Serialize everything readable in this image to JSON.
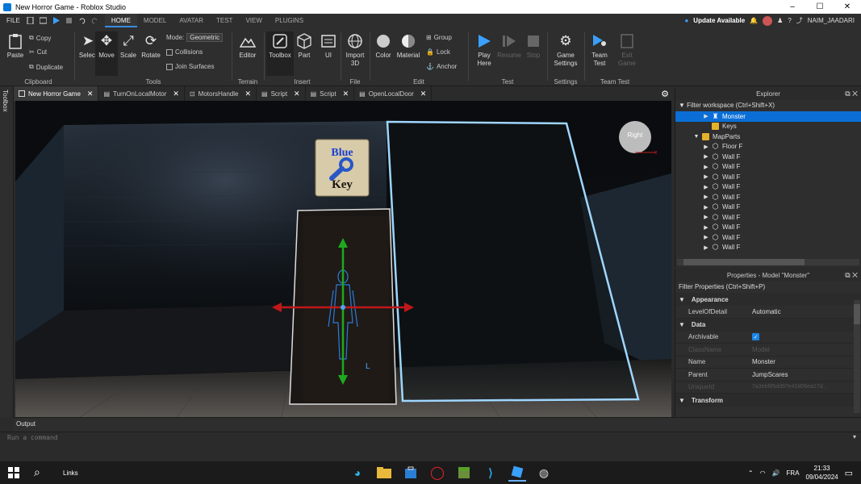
{
  "window": {
    "title": "New Horror Game - Roblox Studio",
    "controls": [
      "–",
      "☐",
      "✕"
    ]
  },
  "menubar": {
    "file": "FILE",
    "tabs": [
      "HOME",
      "MODEL",
      "AVATAR",
      "TEST",
      "VIEW",
      "PLUGINS"
    ],
    "active_tab": "HOME",
    "update": "Update Available",
    "username": "NAIM_JAADARI"
  },
  "ribbon": {
    "clipboard": {
      "label": "Clipboard",
      "paste": "Paste",
      "copy": "Copy",
      "cut": "Cut",
      "duplicate": "Duplicate"
    },
    "tools": {
      "label": "Tools",
      "select": "Select",
      "move": "Move",
      "scale": "Scale",
      "rotate": "Rotate",
      "mode_label": "Mode:",
      "mode_value": "Geometric",
      "collisions": "Collisions",
      "join_surfaces": "Join Surfaces"
    },
    "terrain": {
      "label": "Terrain",
      "editor": "Editor"
    },
    "insert": {
      "label": "Insert",
      "toolbox": "Toolbox",
      "part": "Part",
      "ui": "UI"
    },
    "file": {
      "label": "File",
      "import3d": "Import 3D"
    },
    "edit": {
      "label": "Edit",
      "color": "Color",
      "material": "Material",
      "group": "Group",
      "lock": "Lock",
      "anchor": "Anchor"
    },
    "test": {
      "label": "Test",
      "play_here": "Play Here",
      "resume": "Resume",
      "stop": "Stop"
    },
    "settings": {
      "label": "Settings",
      "game_settings": "Game Settings"
    },
    "team_test": {
      "label": "Team Test",
      "team_test": "Team Test",
      "exit_game": "Exit Game"
    }
  },
  "left_panel": {
    "toolbox": "Toolbox"
  },
  "doc_tabs": [
    {
      "label": "New Horror Game",
      "active": true
    },
    {
      "label": "TurnOnLocalMotor",
      "active": false
    },
    {
      "label": "MotorsHandle",
      "active": false
    },
    {
      "label": "Script",
      "active": false
    },
    {
      "label": "Script",
      "active": false
    },
    {
      "label": "OpenLocalDoor",
      "active": false
    }
  ],
  "viewport": {
    "sign_line1": "Blue",
    "sign_line2": "Key",
    "view_cube": "Right",
    "axis_label": "L",
    "colors": {
      "sign_text": "#1a3fd4",
      "outline": "#9fd6ff",
      "move_x": "#c0181a",
      "move_y": "#1fa81f"
    }
  },
  "explorer": {
    "title": "Explorer",
    "filter": "Filter workspace (Ctrl+Shift+X)",
    "items": [
      {
        "label": "Monster",
        "icon": "model-icon",
        "indent": 2,
        "arrow": "▶",
        "selected": true
      },
      {
        "label": "Keys",
        "icon": "folder-icon",
        "indent": 2,
        "arrow": "",
        "selected": false
      },
      {
        "label": "MapParts",
        "icon": "folder-icon",
        "indent": 1,
        "arrow": "▼",
        "selected": false
      },
      {
        "label": "Floor F",
        "icon": "part-icon",
        "indent": 2,
        "arrow": "▶",
        "selected": false
      },
      {
        "label": "Wall F",
        "icon": "part-icon",
        "indent": 2,
        "arrow": "▶",
        "selected": false
      },
      {
        "label": "Wall F",
        "icon": "part-icon",
        "indent": 2,
        "arrow": "▶",
        "selected": false
      },
      {
        "label": "Wall F",
        "icon": "part-icon",
        "indent": 2,
        "arrow": "▶",
        "selected": false
      },
      {
        "label": "Wall F",
        "icon": "part-icon",
        "indent": 2,
        "arrow": "▶",
        "selected": false
      },
      {
        "label": "Wall F",
        "icon": "part-icon",
        "indent": 2,
        "arrow": "▶",
        "selected": false
      },
      {
        "label": "Wall F",
        "icon": "part-icon",
        "indent": 2,
        "arrow": "▶",
        "selected": false
      },
      {
        "label": "Wall F",
        "icon": "part-icon",
        "indent": 2,
        "arrow": "▶",
        "selected": false
      },
      {
        "label": "Wall F",
        "icon": "part-icon",
        "indent": 2,
        "arrow": "▶",
        "selected": false
      },
      {
        "label": "Wall F",
        "icon": "part-icon",
        "indent": 2,
        "arrow": "▶",
        "selected": false
      },
      {
        "label": "Wall F",
        "icon": "part-icon",
        "indent": 2,
        "arrow": "▶",
        "selected": false
      }
    ]
  },
  "properties": {
    "title": "Properties - Model \"Monster\"",
    "filter": "Filter Properties (Ctrl+Shift+P)",
    "sections": {
      "appearance": "Appearance",
      "data": "Data",
      "transform": "Transform"
    },
    "level_of_detail": {
      "name": "LevelOfDetail",
      "value": "Automatic"
    },
    "archivable": {
      "name": "Archivable"
    },
    "class_name": {
      "name": "ClassName",
      "value": "Model"
    },
    "name": {
      "name": "Name",
      "value": "Monster"
    },
    "parent": {
      "name": "Parent",
      "value": "JumpScares"
    },
    "unique_id": {
      "name": "UniqueId",
      "value": "7a3ebf85dd97e42d06ea17d..."
    }
  },
  "output": {
    "label": "Output"
  },
  "command": {
    "placeholder": "Run a command"
  },
  "taskbar": {
    "search": "Links",
    "lang": "FRA",
    "time": "21:33",
    "date": "09/04/2024"
  }
}
